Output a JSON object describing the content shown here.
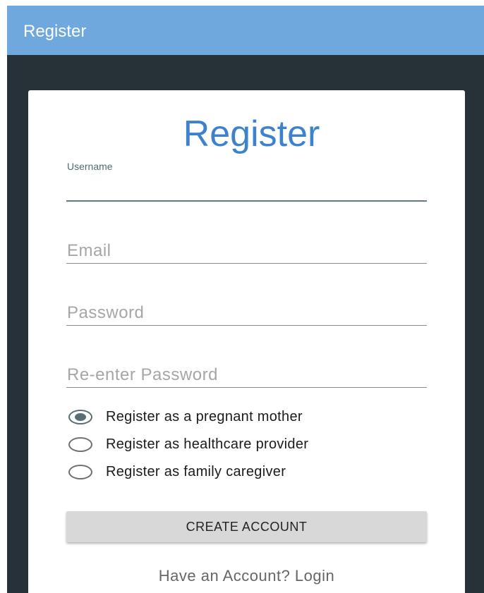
{
  "app_bar": {
    "title": "Register"
  },
  "card": {
    "title": "Register",
    "fields": {
      "username": {
        "label": "Username",
        "value": ""
      },
      "email": {
        "placeholder": "Email",
        "value": ""
      },
      "password": {
        "placeholder": "Password",
        "value": ""
      },
      "reenter_password": {
        "placeholder": "Re-enter Password",
        "value": ""
      }
    },
    "roles": [
      {
        "label": "Register as a pregnant mother",
        "selected": true
      },
      {
        "label": "Register as healthcare provider",
        "selected": false
      },
      {
        "label": "Register as family caregiver",
        "selected": false
      }
    ],
    "create_button": "CREATE ACCOUNT",
    "login_link": "Have an Account? Login"
  },
  "colors": {
    "app_bar": "#6fa8dc",
    "background": "#263238",
    "title": "#3d82cc",
    "focused_field": "#5e7b8a"
  }
}
